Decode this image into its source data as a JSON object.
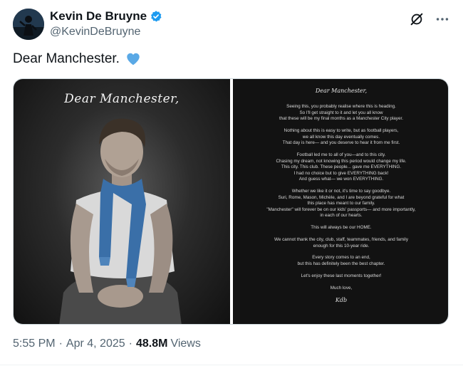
{
  "author": {
    "name": "Kevin De Bruyne",
    "handle": "@KevinDeBruyne"
  },
  "tweet": {
    "text": "Dear Manchester.",
    "emoji": "blue-heart"
  },
  "media": {
    "left_title": "Dear Manchester,",
    "letter": {
      "title": "Dear Manchester,",
      "paragraphs": [
        "Seeing this, you probably realise where this is heading.\nSo I'll get straight to it and let you all know\nthat these will be my final months as a Manchester City player.",
        "Nothing about this is easy to write, but as football players,\nwe all know this day eventually comes.\nThat day is here— and you deserve to hear it from me first.",
        "Football led me to all of you—and to this city.\nChasing my dream, not knowing this period would change my life.\nThis city. This club. These people... gave me EVERYTHING.\nI had no choice but to give EVERYTHING back!\nAnd guess what— we won EVERYTHING.",
        "Whether we like it or not, it's time to say goodbye.\nSuri, Rome, Mason, Michèle, and I are beyond grateful for what\nthis place has meant to our family.\n\"Manchester\" will forever be on our kids' passports— and more importantly,\nin each of our hearts.",
        "This will always be our HOME.",
        "We cannot thank the city, club, staff, teammates, friends, and family\nenough for this 10-year ride.",
        "Every story comes to an end,\nbut this has definitely been the best chapter.",
        "Let's enjoy these last moments together!",
        "Much love,"
      ],
      "signature": "Kdb"
    }
  },
  "meta": {
    "time": "5:55 PM",
    "date": "Apr 4, 2025",
    "views_count": "48.8M",
    "views_label": "Views"
  },
  "colors": {
    "verified": "#1d9bf0",
    "heart": "#5aa9e6",
    "text_secondary": "#536471"
  },
  "icons": [
    "verified-badge-icon",
    "grok-icon",
    "more-icon",
    "blue-heart-icon"
  ]
}
